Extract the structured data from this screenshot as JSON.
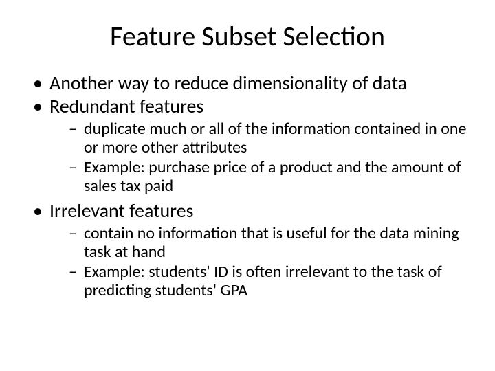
{
  "title": "Feature Subset Selection",
  "bullets": [
    {
      "text": "Another way to reduce dimensionality of data"
    },
    {
      "text": "Redundant features",
      "sub": [
        "duplicate much or all of the information contained in one or more other attributes",
        "Example: purchase price of a product and the amount of sales tax paid"
      ]
    },
    {
      "text": "Irrelevant features",
      "sub": [
        "contain no information that is useful for the data mining task at hand",
        "Example: students' ID is often irrelevant to the task of predicting students' GPA"
      ]
    }
  ]
}
